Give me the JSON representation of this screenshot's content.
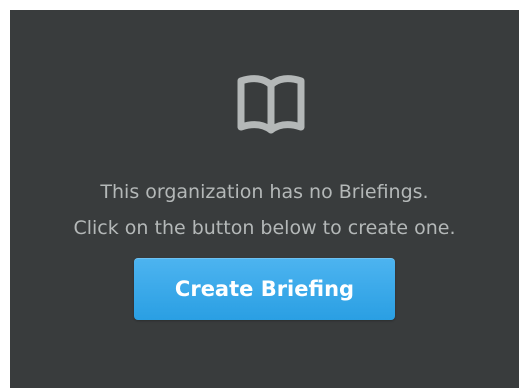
{
  "empty_state": {
    "icon": "book-icon",
    "message_line_1": "This organization has no Briefings.",
    "message_line_2": "Click on the button below to create one."
  },
  "actions": {
    "create_label": "Create Briefing"
  },
  "colors": {
    "panel_background": "#393c3d",
    "message_text": "#b4b8b8",
    "icon": "#b4b8b8",
    "button_background": "#2ea7ea",
    "button_text": "#ffffff"
  }
}
